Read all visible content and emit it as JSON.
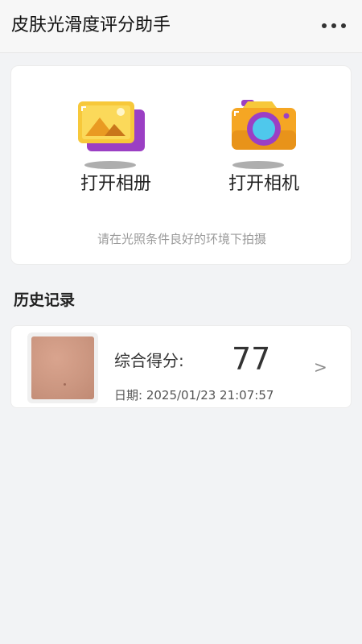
{
  "header": {
    "title": "皮肤光滑度评分助手",
    "menu_icon": "more-dots-icon"
  },
  "actions": {
    "album": {
      "label": "打开相册",
      "icon": "photo-album-icon"
    },
    "camera": {
      "label": "打开相机",
      "icon": "camera-icon"
    },
    "hint": "请在光照条件良好的环境下拍摄"
  },
  "history": {
    "title": "历史记录",
    "records": [
      {
        "score_label": "综合得分:",
        "score": "77",
        "date": "日期: 2025/01/23 21:07:57",
        "chevron": ">"
      }
    ]
  },
  "colors": {
    "background": "#f2f3f5",
    "card": "#ffffff",
    "album_yellow": "#f7c83a",
    "album_purple": "#9b3fc4",
    "camera_orange": "#f5a623",
    "camera_lens": "#4fc8ec"
  }
}
